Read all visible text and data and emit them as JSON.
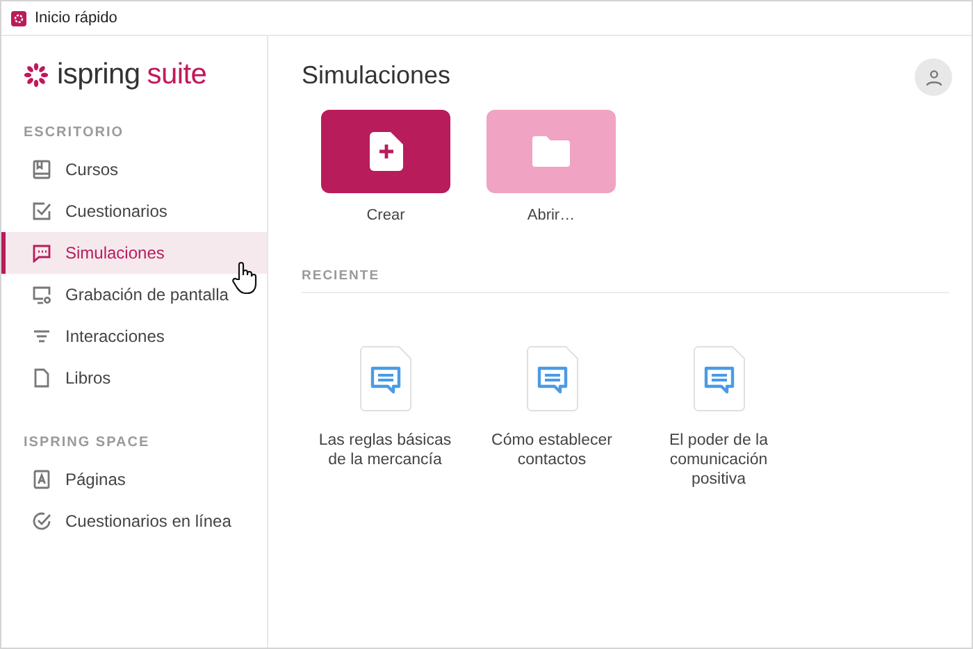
{
  "window": {
    "title": "Inicio rápido"
  },
  "logo": {
    "name": "ispring",
    "suffix": "suite"
  },
  "sidebar": {
    "sections": [
      {
        "heading": "ESCRITORIO",
        "items": [
          {
            "label": "Cursos",
            "kind": "book",
            "selected": false
          },
          {
            "label": "Cuestionarios",
            "kind": "checkbox",
            "selected": false
          },
          {
            "label": "Simulaciones",
            "kind": "chat",
            "selected": true
          },
          {
            "label": "Grabación de pantalla",
            "kind": "screen",
            "selected": false
          },
          {
            "label": "Interacciones",
            "kind": "lines",
            "selected": false
          },
          {
            "label": "Libros",
            "kind": "page",
            "selected": false
          }
        ]
      },
      {
        "heading": "ISPRING SPACE",
        "items": [
          {
            "label": "Páginas",
            "kind": "letter",
            "selected": false
          },
          {
            "label": "Cuestionarios en línea",
            "kind": "checkcircle",
            "selected": false
          }
        ]
      }
    ]
  },
  "main": {
    "title": "Simulaciones",
    "actions": [
      {
        "label": "Crear",
        "kind": "create"
      },
      {
        "label": "Abrir…",
        "kind": "open"
      }
    ],
    "recent_heading": "RECIENTE",
    "recent": [
      {
        "title": "Las reglas básicas de la mercancía"
      },
      {
        "title": "Cómo establecer contactos"
      },
      {
        "title": "El poder de la comunicación positiva"
      }
    ]
  }
}
